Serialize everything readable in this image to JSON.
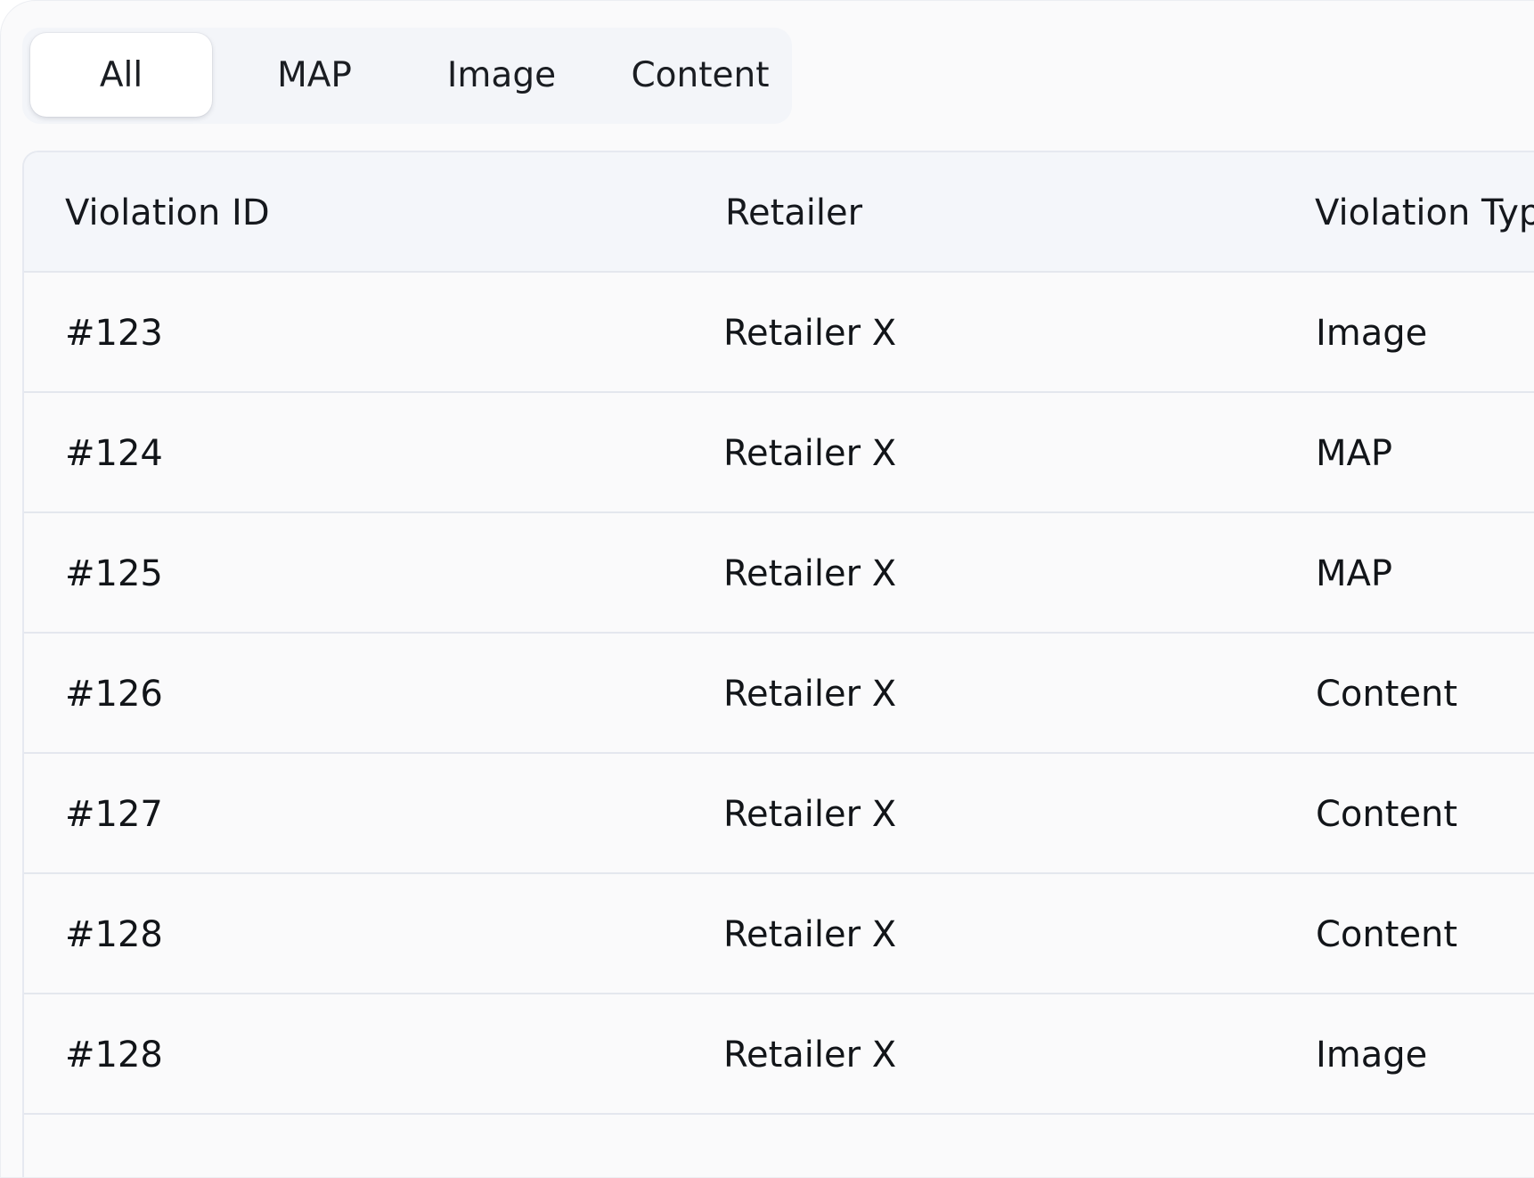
{
  "tabs": [
    {
      "label": "All",
      "active": true
    },
    {
      "label": "MAP",
      "active": false
    },
    {
      "label": "Image",
      "active": false
    },
    {
      "label": "Content",
      "active": false
    }
  ],
  "table": {
    "columns": [
      "Violation ID",
      "Retailer",
      "Violation Typ"
    ],
    "rows": [
      {
        "id": "#123",
        "retailer": "Retailer X",
        "type": "Image"
      },
      {
        "id": "#124",
        "retailer": "Retailer X",
        "type": "MAP"
      },
      {
        "id": "#125",
        "retailer": "Retailer X",
        "type": "MAP"
      },
      {
        "id": "#126",
        "retailer": "Retailer X",
        "type": "Content"
      },
      {
        "id": "#127",
        "retailer": "Retailer X",
        "type": "Content"
      },
      {
        "id": "#128",
        "retailer": "Retailer X",
        "type": "Content"
      },
      {
        "id": "#128",
        "retailer": "Retailer X",
        "type": "Image"
      }
    ]
  },
  "colors": {
    "panel_bg": "#fafafb",
    "tabs_bg": "#f3f5f9",
    "header_bg": "#f4f6fa",
    "border": "#e4e7ee",
    "text": "#121519"
  }
}
